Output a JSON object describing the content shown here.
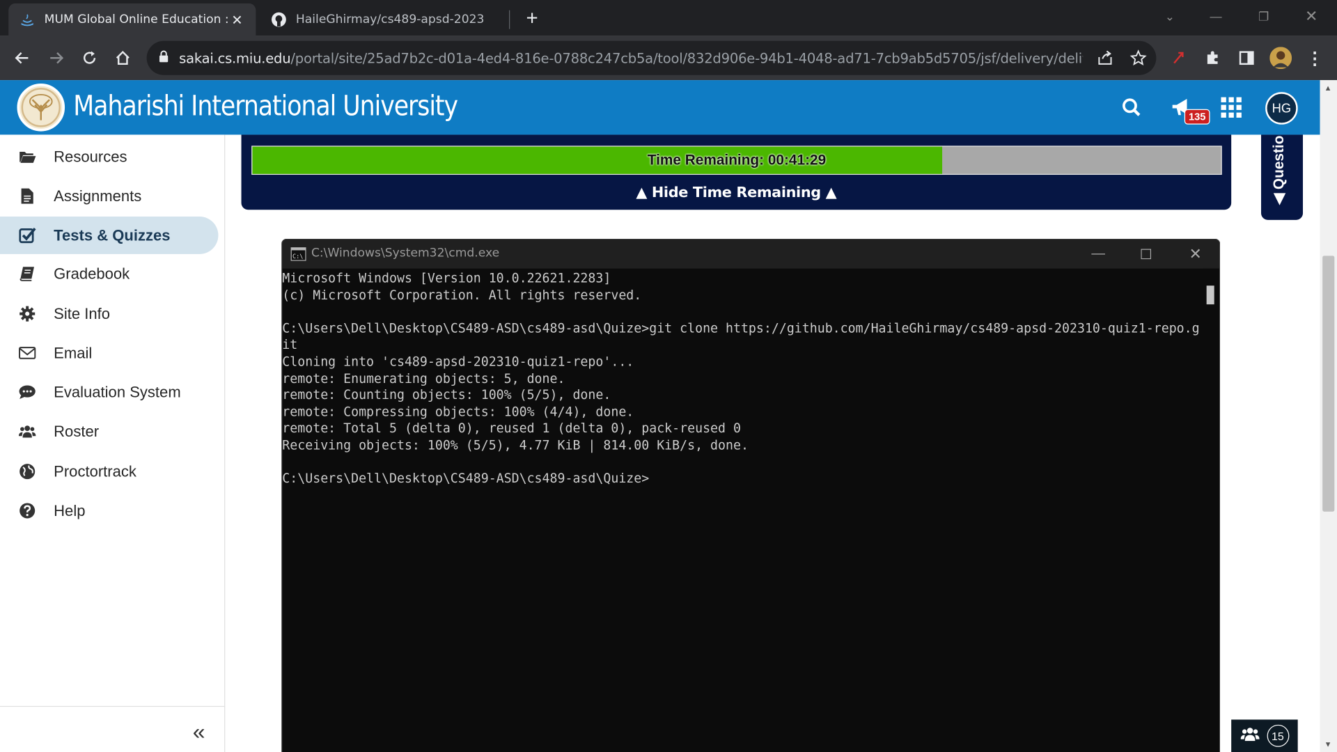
{
  "browser": {
    "tabs": [
      {
        "title": "MUM Global Online Education :",
        "favicon": "graduation-cap-icon",
        "active": true
      },
      {
        "title": "HaileGhirmay/cs489-apsd-2023",
        "favicon": "github-icon",
        "active": false
      }
    ],
    "url_host": "sakai.cs.miu.edu",
    "url_path": "/portal/site/25ad7b2c-d01a-4ed4-816e-0788c247cb5a/tool/832d906e-94b1-4048-ad71-7cb9ab5d5705/jsf/delivery/delive..."
  },
  "site": {
    "name": "Maharishi International University",
    "notification_count": "135",
    "user_initials": "HG"
  },
  "sidebar": {
    "items": [
      {
        "label": "Resources",
        "icon": "folder-open-icon"
      },
      {
        "label": "Assignments",
        "icon": "document-icon"
      },
      {
        "label": "Tests & Quizzes",
        "icon": "checkbox-icon",
        "active": true
      },
      {
        "label": "Gradebook",
        "icon": "book-icon"
      },
      {
        "label": "Site Info",
        "icon": "gear-icon"
      },
      {
        "label": "Email",
        "icon": "envelope-icon"
      },
      {
        "label": "Evaluation System",
        "icon": "speech-bubble-icon"
      },
      {
        "label": "Roster",
        "icon": "users-icon"
      },
      {
        "label": "Proctortrack",
        "icon": "globe-icon"
      },
      {
        "label": "Help",
        "icon": "question-circle-icon"
      }
    ]
  },
  "timer": {
    "label": "Time Remaining: 00:41:29",
    "progress_fraction": 0.712,
    "hide_label": "▲ Hide Time Remaining ▲"
  },
  "question_tab": {
    "label": "◀ Questio"
  },
  "cmd": {
    "title": "C:\\Windows\\System32\\cmd.exe",
    "lines": [
      "Microsoft Windows [Version 10.0.22621.2283]",
      "(c) Microsoft Corporation. All rights reserved.",
      "",
      "C:\\Users\\Dell\\Desktop\\CS489-ASD\\cs489-asd\\Quize>git clone https://github.com/HaileGhirmay/cs489-apsd-202310-quiz1-repo.g",
      "it",
      "Cloning into 'cs489-apsd-202310-quiz1-repo'...",
      "remote: Enumerating objects: 5, done.",
      "remote: Counting objects: 100% (5/5), done.",
      "remote: Compressing objects: 100% (4/4), done.",
      "remote: Total 5 (delta 0), reused 1 (delta 0), pack-reused 0",
      "Receiving objects: 100% (5/5), 4.77 KiB | 814.00 KiB/s, done.",
      "",
      "C:\\Users\\Dell\\Desktop\\CS489-ASD\\cs489-asd\\Quize>"
    ]
  },
  "presence": {
    "count": "15"
  },
  "colors": {
    "header_blue": "#0f7cc4",
    "timer_green": "#4bb700",
    "panel_navy": "#061644"
  }
}
